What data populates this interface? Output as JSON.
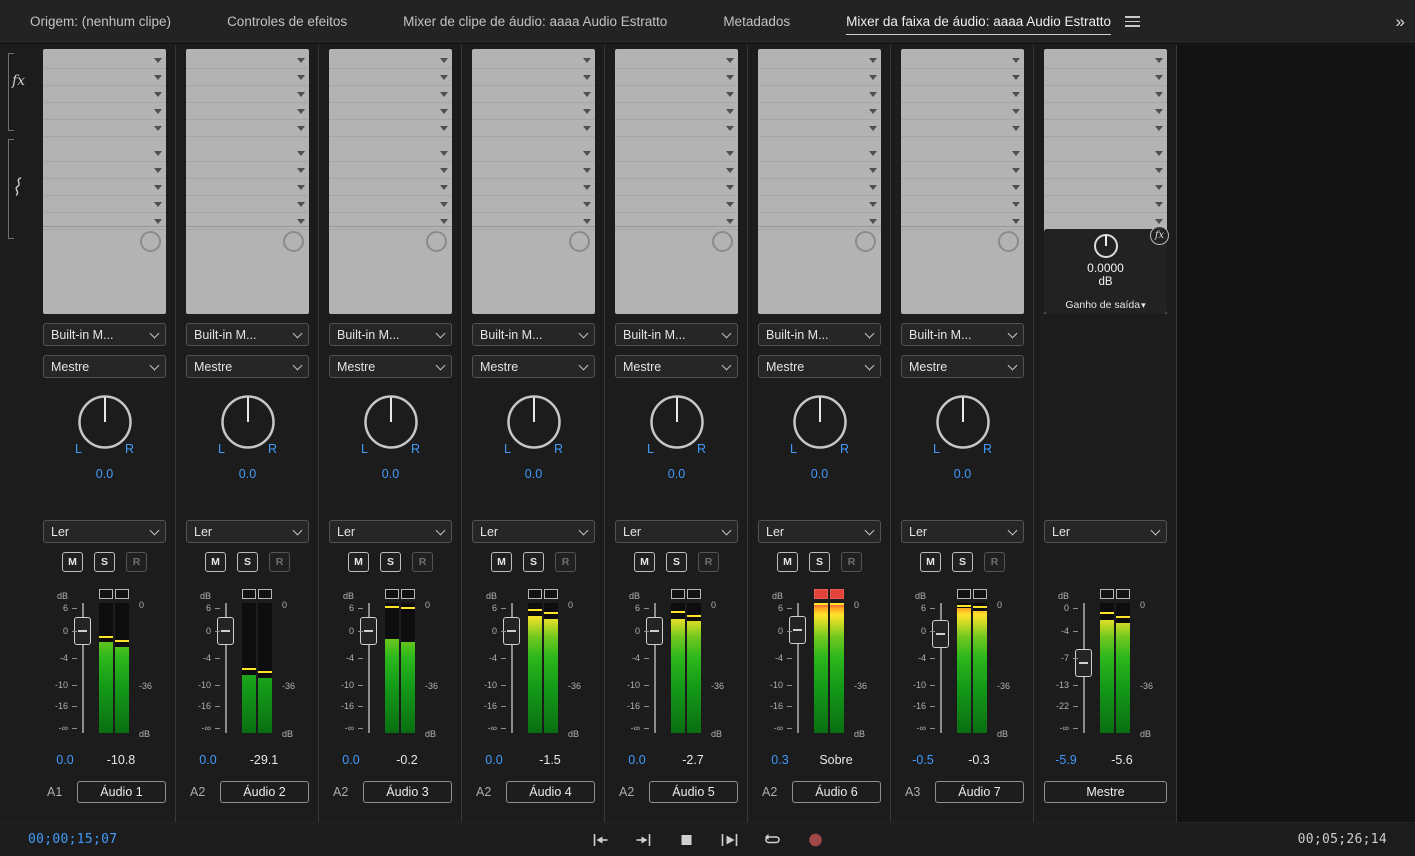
{
  "window": {
    "panel_overflow_icon": "»"
  },
  "tabs": {
    "items": [
      {
        "label": "Origem: (nenhum clipe)",
        "active": false
      },
      {
        "label": "Controles de efeitos",
        "active": false
      },
      {
        "label": "Mixer de clipe de áudio: aaaa Audio Estratto",
        "active": false
      },
      {
        "label": "Metadados",
        "active": false
      },
      {
        "label": "Mixer da faixa de áudio: aaaa Audio Estratto",
        "active": true
      }
    ]
  },
  "sidebar_tools": {
    "effects_icon_label": "fx",
    "sends_icon": "sends-squiggle"
  },
  "strips": [
    {
      "device": "Built-in M...",
      "output": "Mestre",
      "pan": {
        "left": "L",
        "right": "R",
        "value": "0.0"
      },
      "automation": "Ler",
      "buttons": {
        "mute": "M",
        "solo": "S",
        "record": "R"
      },
      "scale_left": [
        "dB",
        "6",
        "0",
        "-4",
        "-10",
        "-16",
        "-∞"
      ],
      "scale_right": [
        "0",
        "-36",
        "dB"
      ],
      "fader_value": "0.0",
      "peak_value": "-10.8",
      "meter": {
        "l": 70,
        "r": 66,
        "peak_l": 74,
        "peak_r": 71,
        "clip": false
      },
      "track_num": "A1",
      "track_name": "Áudio 1"
    },
    {
      "device": "Built-in M...",
      "output": "Mestre",
      "pan": {
        "left": "L",
        "right": "R",
        "value": "0.0"
      },
      "automation": "Ler",
      "buttons": {
        "mute": "M",
        "solo": "S",
        "record": "R"
      },
      "scale_left": [
        "dB",
        "6",
        "0",
        "-4",
        "-10",
        "-16",
        "-∞"
      ],
      "scale_right": [
        "0",
        "-36",
        "dB"
      ],
      "fader_value": "0.0",
      "peak_value": "-29.1",
      "meter": {
        "l": 45,
        "r": 42,
        "peak_l": 49,
        "peak_r": 47,
        "clip": false
      },
      "track_num": "A2",
      "track_name": "Áudio 2"
    },
    {
      "device": "Built-in M...",
      "output": "Mestre",
      "pan": {
        "left": "L",
        "right": "R",
        "value": "0.0"
      },
      "automation": "Ler",
      "buttons": {
        "mute": "M",
        "solo": "S",
        "record": "R"
      },
      "scale_left": [
        "dB",
        "6",
        "0",
        "-4",
        "-10",
        "-16",
        "-∞"
      ],
      "scale_right": [
        "0",
        "-36",
        "dB"
      ],
      "fader_value": "0.0",
      "peak_value": "-0.2",
      "meter": {
        "l": 72,
        "r": 70,
        "peak_l": 97,
        "peak_r": 96,
        "clip": false
      },
      "track_num": "A2",
      "track_name": "Áudio 3"
    },
    {
      "device": "Built-in M...",
      "output": "Mestre",
      "pan": {
        "left": "L",
        "right": "R",
        "value": "0.0"
      },
      "automation": "Ler",
      "buttons": {
        "mute": "M",
        "solo": "S",
        "record": "R"
      },
      "scale_left": [
        "dB",
        "6",
        "0",
        "-4",
        "-10",
        "-16",
        "-∞"
      ],
      "scale_right": [
        "0",
        "-36",
        "dB"
      ],
      "fader_value": "0.0",
      "peak_value": "-1.5",
      "meter": {
        "l": 90,
        "r": 88,
        "peak_l": 95,
        "peak_r": 92,
        "clip": false
      },
      "track_num": "A2",
      "track_name": "Áudio 4"
    },
    {
      "device": "Built-in M...",
      "output": "Mestre",
      "pan": {
        "left": "L",
        "right": "R",
        "value": "0.0"
      },
      "automation": "Ler",
      "buttons": {
        "mute": "M",
        "solo": "S",
        "record": "R"
      },
      "scale_left": [
        "dB",
        "6",
        "0",
        "-4",
        "-10",
        "-16",
        "-∞"
      ],
      "scale_right": [
        "0",
        "-36",
        "dB"
      ],
      "fader_value": "0.0",
      "peak_value": "-2.7",
      "meter": {
        "l": 88,
        "r": 86,
        "peak_l": 93,
        "peak_r": 90,
        "clip": false
      },
      "track_num": "A2",
      "track_name": "Áudio 5"
    },
    {
      "device": "Built-in M...",
      "output": "Mestre",
      "pan": {
        "left": "L",
        "right": "R",
        "value": "0.0"
      },
      "automation": "Ler",
      "buttons": {
        "mute": "M",
        "solo": "S",
        "record": "R"
      },
      "scale_left": [
        "dB",
        "6",
        "0",
        "-4",
        "-10",
        "-16",
        "-∞"
      ],
      "scale_right": [
        "0",
        "-36",
        "dB"
      ],
      "fader_value": "0.3",
      "peak_value": "Sobre",
      "meter": {
        "l": 100,
        "r": 100,
        "peak_l": 100,
        "peak_r": 100,
        "clip": true
      },
      "track_num": "A2",
      "track_name": "Áudio 6"
    },
    {
      "device": "Built-in M...",
      "output": "Mestre",
      "pan": {
        "left": "L",
        "right": "R",
        "value": "0.0"
      },
      "automation": "Ler",
      "buttons": {
        "mute": "M",
        "solo": "S",
        "record": "R"
      },
      "scale_left": [
        "dB",
        "6",
        "0",
        "-4",
        "-10",
        "-16",
        "-∞"
      ],
      "scale_right": [
        "0",
        "-36",
        "dB"
      ],
      "fader_value": "-0.5",
      "peak_value": "-0.3",
      "meter": {
        "l": 96,
        "r": 94,
        "peak_l": 98,
        "peak_r": 97,
        "clip": false
      },
      "track_num": "A3",
      "track_name": "Áudio 7"
    },
    {
      "is_master": true,
      "gain": {
        "value": "0.0000",
        "unit": "dB",
        "label": "Ganho de saída",
        "fx_badge": "fx"
      },
      "automation": "Ler",
      "scale_left": [
        "dB",
        "0",
        "-4",
        "-7",
        "-13",
        "-22",
        "-∞"
      ],
      "scale_right": [
        "0",
        "-36",
        "dB"
      ],
      "fader_value": "-5.9",
      "peak_value": "-5.6",
      "meter": {
        "l": 87,
        "r": 85,
        "peak_l": 92,
        "peak_r": 89,
        "clip": false
      },
      "track_name": "Mestre"
    }
  ],
  "transport": {
    "timecode_current": "00;00;15;07",
    "timecode_end": "00;05;26;14",
    "buttons": [
      "go-to-in",
      "go-to-out",
      "stop",
      "play-in-to-out",
      "loop",
      "record"
    ]
  },
  "colors": {
    "accent_blue": "#419bf9",
    "meter_yellow": "#ffe22a",
    "clip_red": "#e2443c",
    "panel_gray": "#b3b3b3"
  }
}
